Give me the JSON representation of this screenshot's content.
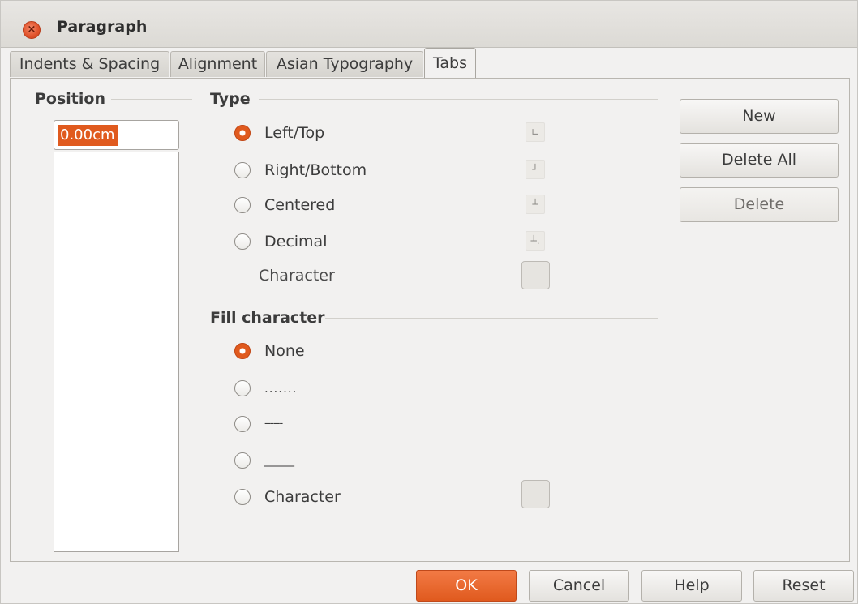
{
  "window": {
    "title": "Paragraph",
    "close_icon": "close-icon"
  },
  "tabs": [
    {
      "label": "Indents & Spacing",
      "active": false
    },
    {
      "label": "Alignment",
      "active": false
    },
    {
      "label": "Asian Typography",
      "active": false
    },
    {
      "label": "Tabs",
      "active": true
    }
  ],
  "position": {
    "heading": "Position",
    "value": "0.00cm"
  },
  "type": {
    "heading": "Type",
    "options": [
      {
        "label": "Left/Top",
        "checked": true,
        "icon": "tab-left-icon"
      },
      {
        "label": "Right/Bottom",
        "checked": false,
        "icon": "tab-right-icon"
      },
      {
        "label": "Centered",
        "checked": false,
        "icon": "tab-center-icon"
      },
      {
        "label": "Decimal",
        "checked": false,
        "icon": "tab-decimal-icon"
      }
    ],
    "character_label": "Character"
  },
  "fill": {
    "heading": "Fill character",
    "options": [
      {
        "label": "None",
        "checked": true
      },
      {
        "label": ".......",
        "checked": false
      },
      {
        "label": "------",
        "checked": false
      },
      {
        "label": "______",
        "checked": false
      },
      {
        "label": "Character",
        "checked": false
      }
    ]
  },
  "side_buttons": {
    "new": "New",
    "delete_all": "Delete All",
    "delete": "Delete"
  },
  "bottom_buttons": {
    "ok": "OK",
    "cancel": "Cancel",
    "help": "Help",
    "reset": "Reset"
  },
  "colors": {
    "accent": "#e05a1e",
    "window_bg": "#f2f1f0"
  }
}
